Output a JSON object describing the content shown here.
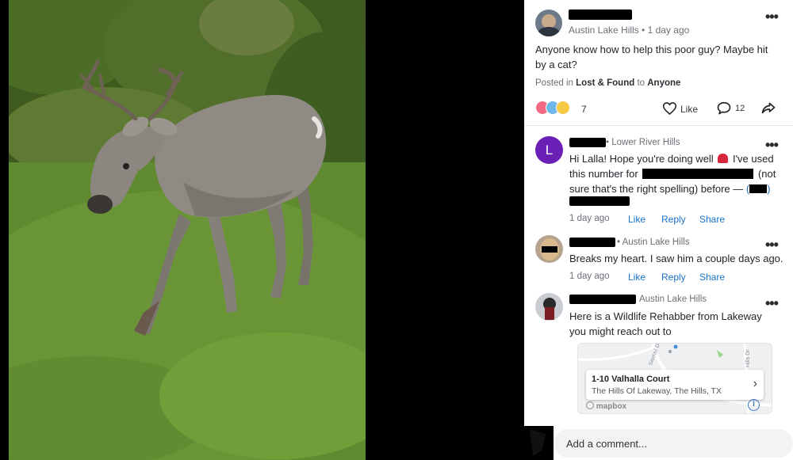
{
  "post": {
    "author_meta": "Austin Lake Hills • 1 day ago",
    "text": "Anyone know how to help this poor guy? Maybe hit by a cat?",
    "posted_in_prefix": "Posted in",
    "category": "Lost & Found",
    "audience_prefix": "to",
    "audience": "Anyone",
    "reaction_count": "7",
    "like_label": "Like",
    "comment_count": "12"
  },
  "comments": [
    {
      "avatar_letter": "L",
      "author_meta": "• Lower River Hills",
      "text_1": "Hi Lalla! Hope you're doing well",
      "text_2": "I've used",
      "text_3": "this number for",
      "text_4": "(not",
      "text_5": "sure that's the right spelling) before —",
      "text_6": "(",
      "text_7": ")",
      "time": "1 day ago",
      "like": "Like",
      "reply": "Reply",
      "share": "Share"
    },
    {
      "author_meta": "• Austin Lake Hills",
      "text": "Breaks my heart. I saw him a couple days ago.",
      "time": "1 day ago",
      "like": "Like",
      "reply": "Reply",
      "share": "Share"
    },
    {
      "author_meta": "Austin Lake Hills",
      "text": "Here is a Wildlife Rehabber from Lakeway you might reach out to",
      "map": {
        "title": "1-10 Valhalla Court",
        "subtitle": "The Hills Of Lakeway, The Hills, TX",
        "road_1": "Sierrail Dr",
        "road_2": "Hills Dr",
        "attribution": "mapbox"
      }
    }
  ],
  "compose": {
    "placeholder": "Add a comment..."
  },
  "colors": {
    "link_blue": "#1a73c9",
    "avatar_purple": "#6a1fb5",
    "grass": "#5b7a2e"
  }
}
